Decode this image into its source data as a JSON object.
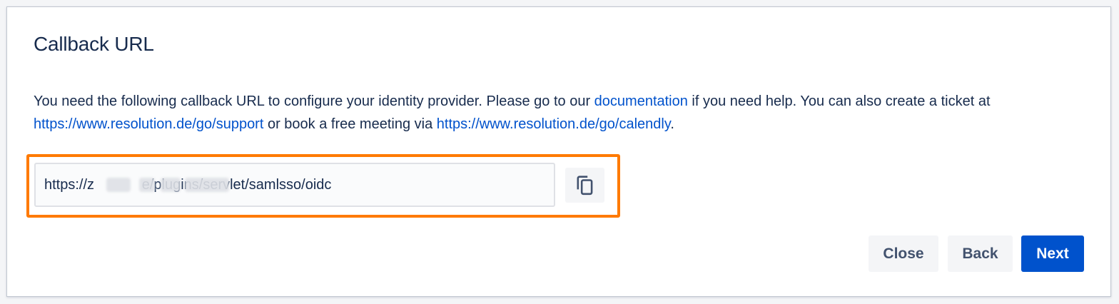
{
  "dialog": {
    "title": "Callback URL",
    "description": {
      "part1": "You need the following callback URL to configure your identity provider. Please go to our ",
      "link_documentation": "documentation",
      "part2": " if you need help. You can also create a ticket at ",
      "link_support": "https://www.resolution.de/go/support",
      "part3": " or book a free meeting via ",
      "link_calendly": "https://www.resolution.de/go/calendly",
      "part4": "."
    },
    "callback_url": {
      "value": "https://z            e/plugins/servlet/samlsso/oidc",
      "highlight_color": "#ff7a00"
    },
    "copy_button": {
      "icon": "copy-icon"
    },
    "buttons": {
      "close_label": "Close",
      "back_label": "Back",
      "next_label": "Next"
    }
  },
  "colors": {
    "primary": "#0052cc",
    "text": "#172b4d",
    "link": "#0052cc",
    "highlight": "#ff7a00",
    "subtle_button": "#f4f5f7"
  }
}
